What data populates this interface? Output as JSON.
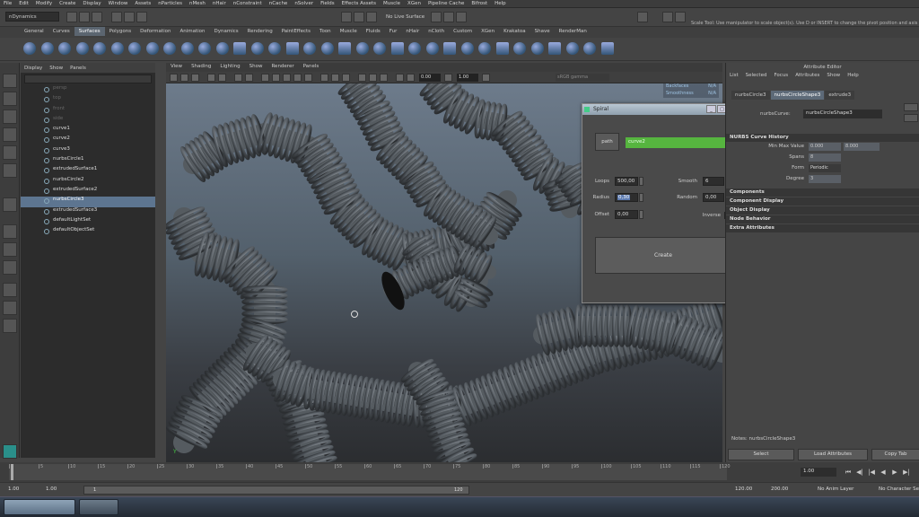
{
  "menubar": {
    "items": [
      "File",
      "Edit",
      "Modify",
      "Create",
      "Display",
      "Window",
      "Assets",
      "nParticles",
      "nMesh",
      "nHair",
      "nConstraint",
      "nCache",
      "nSolver",
      "Fields",
      "Effects Assets",
      "Muscle",
      "XGen",
      "Pipeline Cache",
      "Bifrost",
      "Help"
    ]
  },
  "statusline": {
    "menuset": "nDynamics",
    "live_surface": "No Live Surface",
    "help_text": "Scale Tool: Use manipulator to scale object(s). Use D or INSERT to change the pivot position and axis"
  },
  "shelf": {
    "tabs": [
      "General",
      "Curves",
      "Surfaces",
      "Polygons",
      "Deformation",
      "Animation",
      "Dynamics",
      "Rendering",
      "PaintEffects",
      "Toon",
      "Muscle",
      "Fluids",
      "Fur",
      "nHair",
      "nCloth",
      "Custom",
      "XGen",
      "Krakatoa",
      "Shave",
      "RenderMan"
    ],
    "active_tab": "Surfaces"
  },
  "outliner": {
    "menu": [
      "Display",
      "Show",
      "Panels"
    ],
    "items": [
      {
        "label": "persp",
        "dim": true,
        "selected": false
      },
      {
        "label": "top",
        "dim": true,
        "selected": false
      },
      {
        "label": "front",
        "dim": true,
        "selected": false
      },
      {
        "label": "side",
        "dim": true,
        "selected": false
      },
      {
        "label": "curve1",
        "dim": false,
        "selected": false
      },
      {
        "label": "curve2",
        "dim": false,
        "selected": false
      },
      {
        "label": "curve3",
        "dim": false,
        "selected": false
      },
      {
        "label": "nurbsCircle1",
        "dim": false,
        "selected": false
      },
      {
        "label": "extrudedSurface1",
        "dim": false,
        "selected": false
      },
      {
        "label": "nurbsCircle2",
        "dim": false,
        "selected": false
      },
      {
        "label": "extrudedSurface2",
        "dim": false,
        "selected": false
      },
      {
        "label": "nurbsCircle3",
        "dim": false,
        "selected": true
      },
      {
        "label": "extrudedSurface3",
        "dim": false,
        "selected": false
      },
      {
        "label": "defaultLightSet",
        "dim": false,
        "selected": false
      },
      {
        "label": "defaultObjectSet",
        "dim": false,
        "selected": false
      }
    ]
  },
  "viewport": {
    "menu": [
      "View",
      "Shading",
      "Lighting",
      "Show",
      "Renderer",
      "Panels"
    ],
    "field_a": "0.00",
    "field_b": "1.00",
    "colorspace": "sRGB gamma",
    "hud": [
      {
        "label": "Backfaces",
        "value": "N/A"
      },
      {
        "label": "Smoothness",
        "value": "N/A"
      }
    ],
    "axis_label": "Y"
  },
  "spiral_window": {
    "title": "Spiral",
    "path_button": "path",
    "path_value": "curve2",
    "loops_label": "Loops",
    "loops_value": "500,00",
    "smooth_label": "Smooth",
    "smooth_value": "6",
    "radius_label": "Radius",
    "radius_value": "0,30",
    "random_label": "Random",
    "random_value": "0,00",
    "offset_label": "Offset",
    "offset_value": "0,00",
    "inverse_label": "Inverse",
    "create_label": "Create"
  },
  "attribute_editor": {
    "title": "Attribute Editor",
    "menu": [
      "List",
      "Selected",
      "Focus",
      "Attributes",
      "Show",
      "Help"
    ],
    "tabs": [
      "nurbsCircle3",
      "nurbsCircleShape3",
      "extrude3"
    ],
    "active_tab": "nurbsCircleShape3",
    "node_label": "nurbsCurve:",
    "node_value": "nurbsCircleShape3",
    "history_section": "NURBS Curve History",
    "min_max_label": "Min Max Value",
    "min_value": "0.000",
    "max_value": "8.000",
    "spans_label": "Spans",
    "spans_value": "8",
    "form_label": "Form",
    "form_value": "Periodic",
    "degree_label": "Degree",
    "degree_value": "3",
    "sections": [
      "Components",
      "Component Display",
      "Object Display",
      "Node Behavior",
      "Extra Attributes"
    ],
    "notes": "Notes: nurbsCircleShape3",
    "buttons": [
      "Select",
      "Load Attributes",
      "Copy Tab"
    ]
  },
  "time_slider": {
    "ticks": [
      "1",
      "5",
      "10",
      "15",
      "20",
      "25",
      "30",
      "35",
      "40",
      "45",
      "50",
      "55",
      "60",
      "65",
      "70",
      "75",
      "80",
      "85",
      "90",
      "95",
      "100",
      "105",
      "110",
      "115",
      "120"
    ],
    "current_frame": "1.00"
  },
  "range_slider": {
    "start": "1.00",
    "anim_start": "1.00",
    "range_start": "1",
    "range_end": "120",
    "anim_end": "120.00",
    "end": "200.00",
    "anim_layer": "No Anim Layer",
    "char_set": "No Character Set"
  }
}
